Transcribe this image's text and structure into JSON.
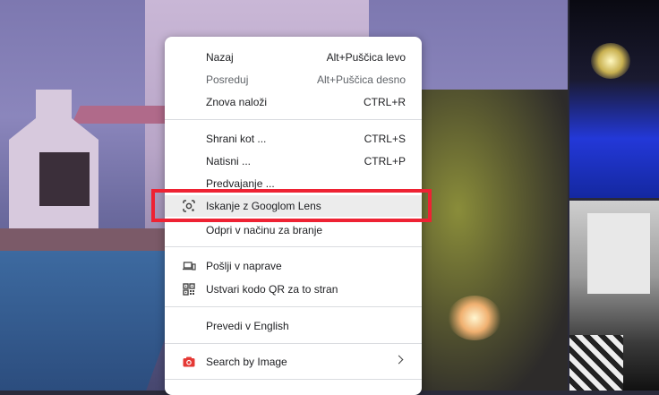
{
  "context_menu": {
    "groups": [
      [
        {
          "label": "Nazaj",
          "shortcut": "Alt+Puščica levo",
          "disabled": false
        },
        {
          "label": "Posreduj",
          "shortcut": "Alt+Puščica desno",
          "disabled": true
        },
        {
          "label": "Znova naloži",
          "shortcut": "CTRL+R",
          "disabled": false
        }
      ],
      [
        {
          "label": "Shrani kot ...",
          "shortcut": "CTRL+S"
        },
        {
          "label": "Natisni ...",
          "shortcut": "CTRL+P"
        },
        {
          "label": "Predvajanje ..."
        },
        {
          "label": "Iskanje z Googlom Lens",
          "icon": "lens-icon",
          "highlighted": true
        },
        {
          "label": "Odpri v načinu za branje"
        }
      ],
      [
        {
          "label": "Pošlji v naprave",
          "icon": "send-to-devices-icon"
        },
        {
          "label": "Ustvari kodo QR za to stran",
          "icon": "qr-code-icon"
        }
      ],
      [
        {
          "label": "Prevedi v English"
        }
      ],
      [
        {
          "label": "Search by Image",
          "icon": "camera-icon",
          "submenu": true
        }
      ]
    ]
  },
  "colors": {
    "highlight_outline": "#ee2233",
    "camera_icon": "#e53935",
    "menu_bg": "#ffffff",
    "separator": "#dadce0"
  }
}
